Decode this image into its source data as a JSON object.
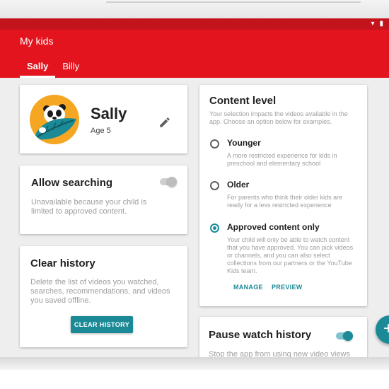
{
  "app": {
    "title": "My kids"
  },
  "tabs": [
    {
      "label": "Sally",
      "active": true
    },
    {
      "label": "Billy",
      "active": false
    }
  ],
  "profile": {
    "name": "Sally",
    "age": "Age 5",
    "avatar_icon": "bear-with-leaf-avatar",
    "edit_icon": "pencil-icon"
  },
  "allow_searching": {
    "title": "Allow searching",
    "description": "Unavailable because your child is limited to approved content.",
    "toggle_on": false
  },
  "clear_history": {
    "title": "Clear history",
    "description": "Delete the list of videos you watched, searches, recommendations, and videos you saved offline.",
    "button_label": "CLEAR HISTORY"
  },
  "content_level": {
    "title": "Content level",
    "description": "Your selection impacts the videos available in the app. Choose an option below for examples.",
    "options": [
      {
        "label": "Younger",
        "description": "A more restricted experience for kids in preschool and elementary school",
        "selected": false
      },
      {
        "label": "Older",
        "description": "For parents who think their older kids are ready for a less restricted experience",
        "selected": false
      },
      {
        "label": "Approved content only",
        "description": "Your child will only be able to watch content that you have approved. You can pick videos or channels, and you can also select collections from our partners or the YouTube Kids team.",
        "selected": true
      }
    ],
    "manage_label": "MANAGE",
    "preview_label": "PREVIEW"
  },
  "pause_watch_history": {
    "title": "Pause watch history",
    "description": "Stop the app from using new video views",
    "toggle_on": true
  },
  "fab": {
    "label": "+"
  },
  "colors": {
    "brand_red": "#e3141d",
    "status_red": "#c4141b",
    "accent_teal": "#1b8a96",
    "background": "#eeeeee"
  }
}
